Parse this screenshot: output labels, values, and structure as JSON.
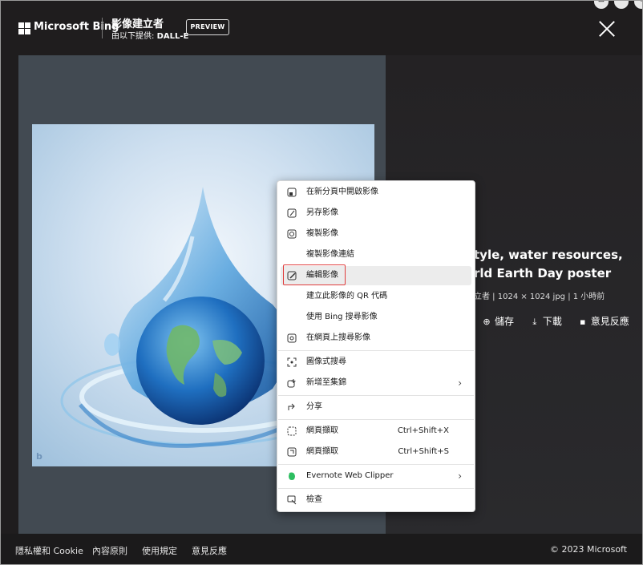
{
  "header": {
    "brand": "Microsoft Bing",
    "creator_title": "影像建立者",
    "creator_sub_prefix": "由以下提供: ",
    "creator_sub_brand": "DALL-E",
    "preview_label": "PREVIEW"
  },
  "corner_buttons": [
    "⊞",
    "···",
    "+"
  ],
  "image": {
    "watermark": "b"
  },
  "info": {
    "title_line1": "tyle, water resources,",
    "title_line2": "rld Earth Day poster",
    "meta": "立者  |  1024 × 1024 jpg  |  1 小時前",
    "actions": [
      {
        "icon": "collection-icon",
        "glyph": "⊕",
        "label": "儲存"
      },
      {
        "icon": "download-icon",
        "glyph": "⤓",
        "label": "下載"
      },
      {
        "icon": "feedback-icon",
        "glyph": "▪",
        "label": "意見反應"
      }
    ]
  },
  "context_menu": {
    "items": [
      {
        "label": "在新分頁中開啟影像",
        "icon": "open-new-tab-icon"
      },
      {
        "label": "另存影像",
        "icon": "save-image-icon"
      },
      {
        "label": "複製影像",
        "icon": "copy-image-icon"
      },
      {
        "label": "複製影像連結",
        "icon": ""
      },
      {
        "label": "編輯影像",
        "icon": "edit-image-icon"
      },
      {
        "label": "建立此影像的 QR 代碼",
        "icon": ""
      },
      {
        "label": "使用 Bing 搜尋影像",
        "icon": ""
      },
      {
        "label": "在網頁上搜尋影像",
        "icon": "search-web-image-icon"
      },
      {
        "label": "圖像式搜尋",
        "icon": "visual-search-icon"
      },
      {
        "label": "新增至集錦",
        "icon": "add-collection-icon"
      },
      {
        "label": "分享",
        "icon": "share-icon"
      },
      {
        "label": "網頁擷取",
        "icon": "web-capture-icon",
        "shortcut": "Ctrl+Shift+X"
      },
      {
        "label": "網頁擷取",
        "icon": "web-select-icon",
        "shortcut": "Ctrl+Shift+S"
      },
      {
        "label": "Evernote Web Clipper",
        "icon": "evernote-icon"
      },
      {
        "label": "檢查",
        "icon": "inspect-icon"
      }
    ]
  },
  "footer": {
    "links": [
      "隱私權和 Cookie",
      "內容原則",
      "使用規定",
      "意見反應"
    ],
    "copyright": "© 2023 Microsoft"
  },
  "colors": {
    "background": "#1f1d1e",
    "highlight_border": "#e03c3c",
    "evernote_green": "#2dbe60"
  }
}
